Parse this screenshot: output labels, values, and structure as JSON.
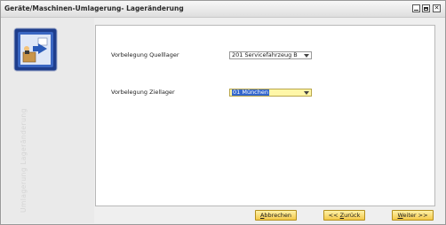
{
  "window": {
    "title": "Geräte/Maschinen-Umlagerung- Lageränderung",
    "controls": {
      "minimize": "minimize",
      "maximize": "maximize",
      "close": "close"
    }
  },
  "sidebar": {
    "vertical_text": "Umlagerung Lageränderung",
    "icon": "inventory-transfer-icon"
  },
  "form": {
    "source_label": "Vorbelegung Quelllager",
    "source_value": "201 Servicefahrzeug B",
    "target_label": "Vorbelegung Ziellager",
    "target_value": "01 München"
  },
  "buttons": {
    "cancel": {
      "acc": "A",
      "rest": "bbrechen"
    },
    "back": {
      "pre": "<< ",
      "acc": "Z",
      "rest": "urück"
    },
    "next": {
      "acc": "W",
      "rest": "eiter >>"
    }
  },
  "colors": {
    "button_fill": "#f3c94a",
    "focus_field": "#fff7a8",
    "selection": "#3366cc"
  }
}
